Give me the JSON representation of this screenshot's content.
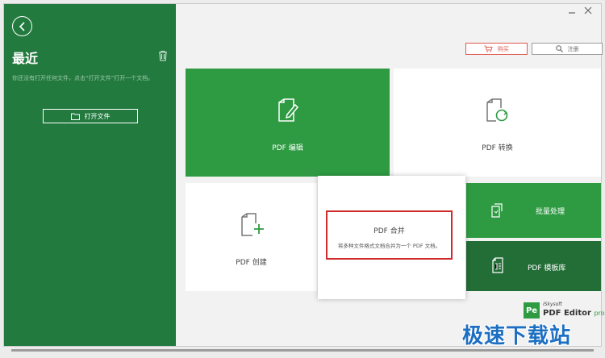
{
  "sidebar": {
    "title": "最近",
    "hint": "你还没有打开任何文件，点击“打开文件”打开一个文档。",
    "open_file_label": "打开文件"
  },
  "header": {
    "buy_label": "购买",
    "register_label": "注册"
  },
  "tiles": {
    "edit": "PDF 编辑",
    "convert": "PDF 转换",
    "create": "PDF 创建",
    "merge_title": "PDF 合并",
    "merge_desc": "将多种文件格式文档合并为一个 PDF 文档。",
    "batch": "批量处理",
    "template": "PDF 模板库"
  },
  "brand": {
    "logo": "Pe",
    "company": "iSkysoft",
    "product": "PDF Editor",
    "edition": "pro"
  },
  "watermark": "极速下载站",
  "colors": {
    "sidebar": "#227a3f",
    "accent_green": "#2e9b42",
    "dark_green": "#236d36",
    "highlight_red": "#d02b2b",
    "buy_red": "#e05a4e"
  },
  "icons": [
    "back-icon",
    "trash-icon",
    "folder-icon",
    "cart-icon",
    "search-icon",
    "edit-doc-icon",
    "convert-doc-icon",
    "add-doc-icon",
    "batch-icon",
    "template-icon"
  ]
}
